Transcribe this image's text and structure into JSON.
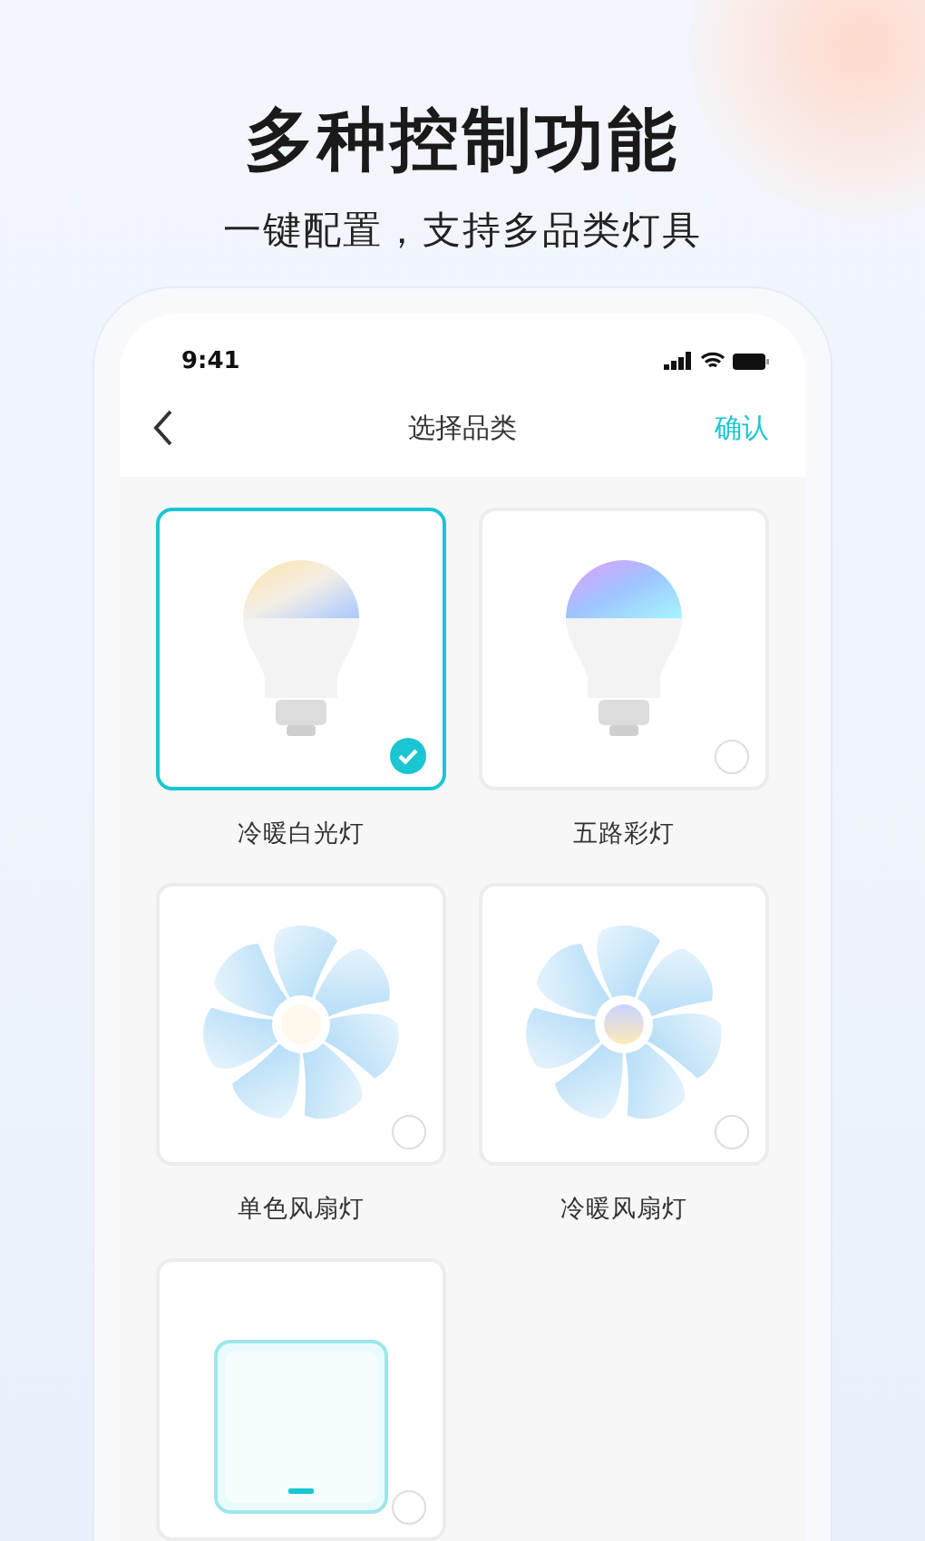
{
  "headline": "多种控制功能",
  "subtitle": "一键配置，支持多品类灯具",
  "status_bar": {
    "time": "9:41"
  },
  "nav": {
    "title": "选择品类",
    "action": "确认"
  },
  "categories": [
    {
      "kind": "bulb-cct",
      "label": "冷暖白光灯",
      "selected": true
    },
    {
      "kind": "bulb-rgb",
      "label": "五路彩灯",
      "selected": false
    },
    {
      "kind": "fan-mono",
      "label": "单色风扇灯",
      "selected": false
    },
    {
      "kind": "fan-cct",
      "label": "冷暖风扇灯",
      "selected": false
    },
    {
      "kind": "panel",
      "selected": false
    }
  ]
}
